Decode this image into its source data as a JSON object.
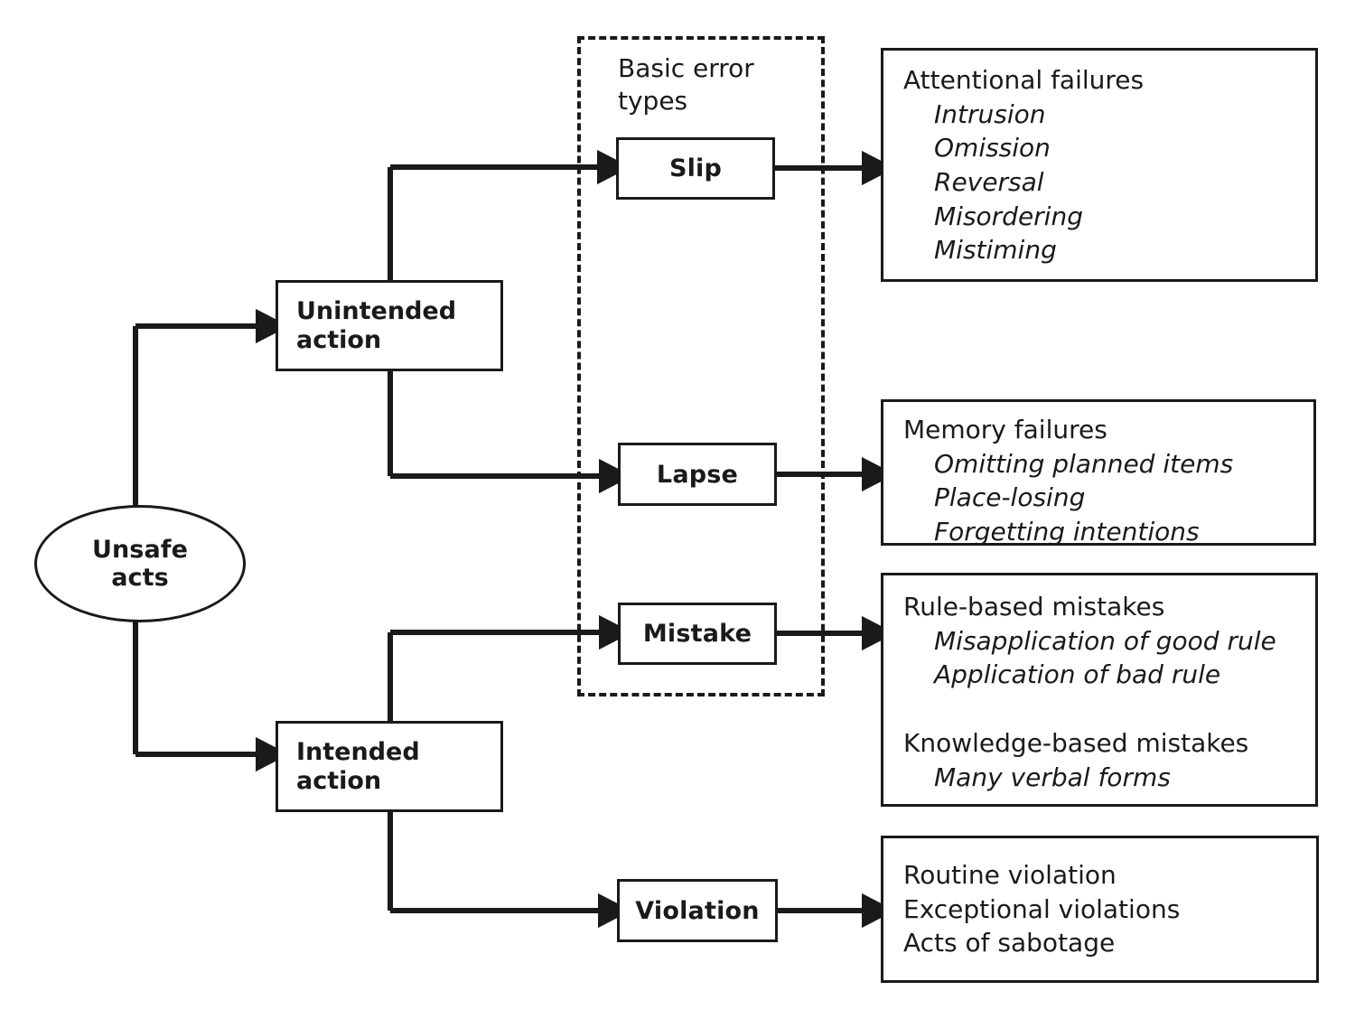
{
  "diagram": {
    "root": {
      "label": "Unsafe\nacts"
    },
    "group_caption": "Basic error\ntypes",
    "stage_nodes": [
      {
        "id": "unintended",
        "label": "Unintended\naction"
      },
      {
        "id": "intended",
        "label": "Intended\naction"
      }
    ],
    "error_types": [
      {
        "id": "slip",
        "label": "Slip"
      },
      {
        "id": "lapse",
        "label": "Lapse"
      },
      {
        "id": "mistake",
        "label": "Mistake"
      },
      {
        "id": "violation",
        "label": "Violation"
      }
    ],
    "panels": [
      {
        "id": "attentional",
        "heading": "Attentional failures",
        "items": [
          "Intrusion",
          "Omission",
          "Reversal",
          "Misordering",
          "Mistiming"
        ],
        "italic_items": true
      },
      {
        "id": "memory",
        "heading": "Memory failures",
        "items": [
          "Omitting planned items",
          "Place-losing",
          "Forgetting intentions"
        ],
        "italic_items": true
      },
      {
        "id": "mistakes",
        "heading": "Rule-based mistakes",
        "items": [
          "Misapplication of good rule",
          "Application of bad rule"
        ],
        "heading2": "Knowledge-based mistakes",
        "items2": [
          "Many verbal forms"
        ],
        "italic_items": true
      },
      {
        "id": "violations",
        "lines": [
          "Routine violation",
          "Exceptional violations",
          "Acts of sabotage"
        ],
        "italic_items": false
      }
    ],
    "colors": {
      "stroke": "#1a1a1a",
      "background": "#ffffff"
    }
  }
}
